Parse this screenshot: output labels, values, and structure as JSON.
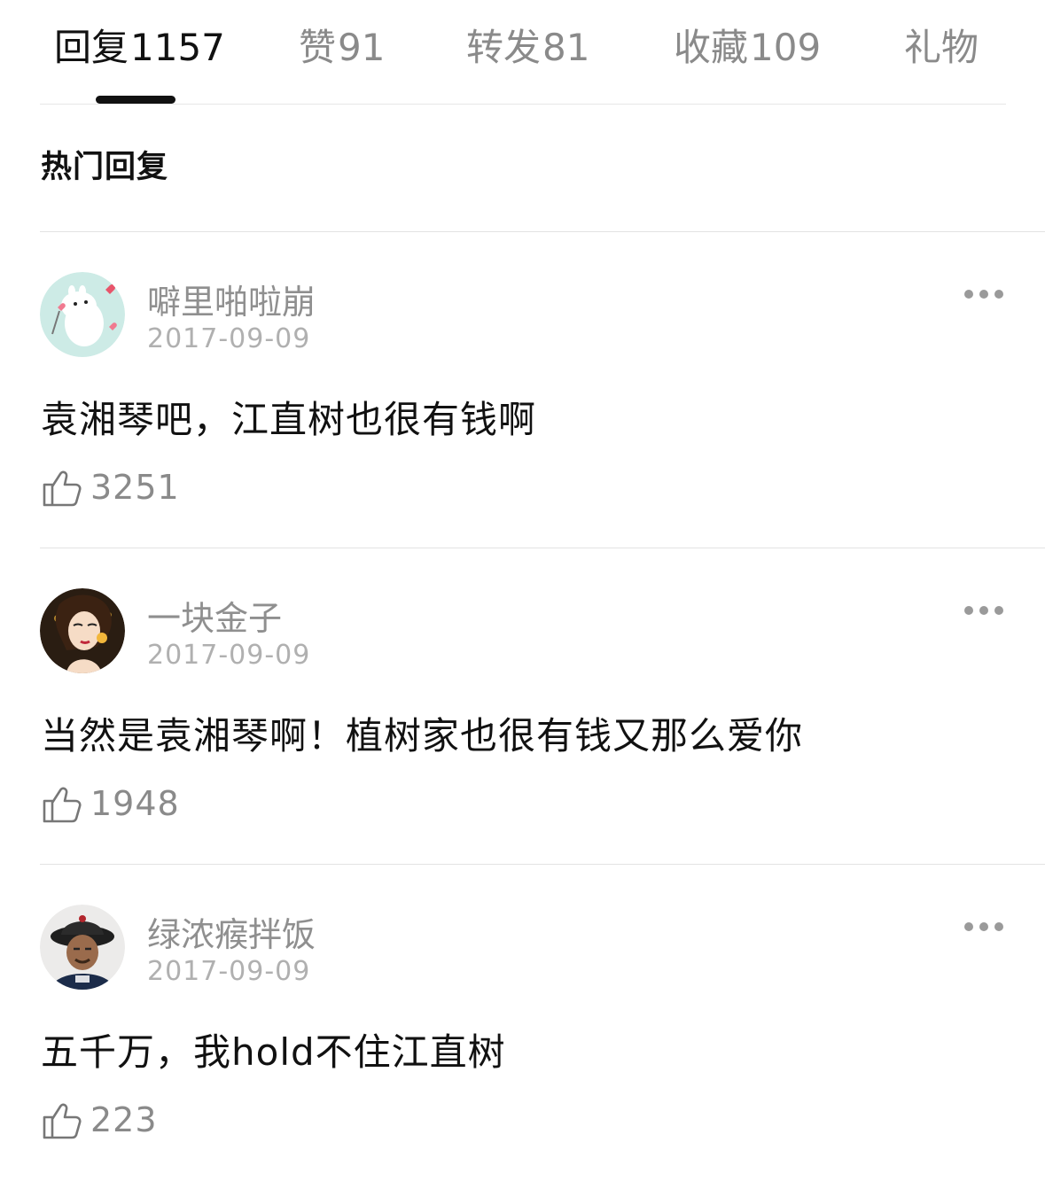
{
  "tabs": [
    {
      "label": "回复",
      "count": "1157"
    },
    {
      "label": "赞",
      "count": "91"
    },
    {
      "label": "转发",
      "count": "81"
    },
    {
      "label": "收藏",
      "count": "109"
    },
    {
      "label": "礼物",
      "count": ""
    }
  ],
  "active_tab": 0,
  "section_title": "热门回复",
  "comments": [
    {
      "username": "噼里啪啦崩",
      "date": "2017-09-09",
      "text": "袁湘琴吧，江直树也很有钱啊",
      "likes": "3251",
      "avatar": "moomin-avatar-icon"
    },
    {
      "username": "一块金子",
      "date": "2017-09-09",
      "text": "当然是袁湘琴啊！植树家也很有钱又那么爱你",
      "likes": "1948",
      "avatar": "cartoon-woman-avatar-icon"
    },
    {
      "username": "绿浓瘊拌饭",
      "date": "2017-09-09",
      "text": "五千万，我hold不住江直树",
      "likes": "223",
      "avatar": "man-in-hat-avatar-icon"
    }
  ],
  "icons": {
    "like": "thumbs-up-icon",
    "more": "more-dots-icon"
  },
  "colors": {
    "text": "#111111",
    "muted": "#8a8a8a",
    "date": "#b0b0b0",
    "divider": "#e3e3e3"
  }
}
